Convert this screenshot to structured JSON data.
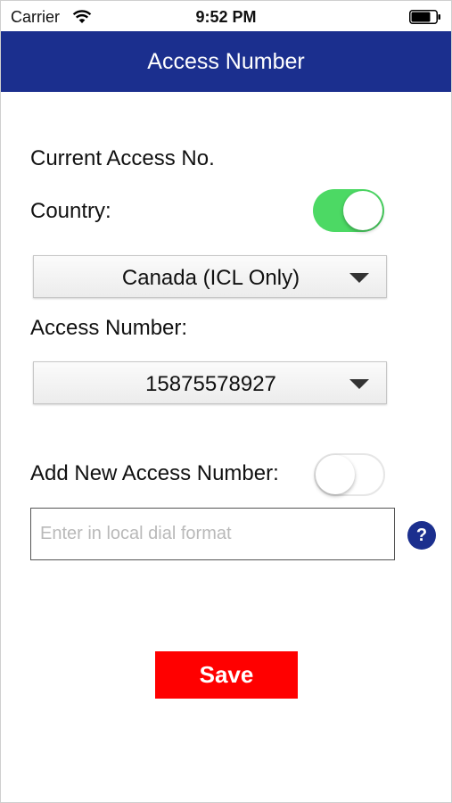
{
  "status_bar": {
    "carrier": "Carrier",
    "time": "9:52 PM",
    "wifi_icon": "wifi-icon",
    "battery_icon": "battery-icon"
  },
  "header": {
    "title": "Access Number",
    "background_color": "#1b2f8e"
  },
  "form": {
    "current_access_label": "Current Access No.",
    "country_label": "Country:",
    "country_toggle_on": true,
    "country_select_value": "Canada (ICL Only)",
    "access_number_label": "Access Number:",
    "access_number_value": "15875578927",
    "add_new_label": "Add New Access Number:",
    "add_new_toggle_on": false,
    "new_number_value": "",
    "new_number_placeholder": "Enter in local dial format",
    "help_label": "?",
    "save_label": "Save"
  },
  "colors": {
    "toggle_on": "#4cd964",
    "save_button": "#ff0000",
    "help_button": "#1b2f8e"
  }
}
